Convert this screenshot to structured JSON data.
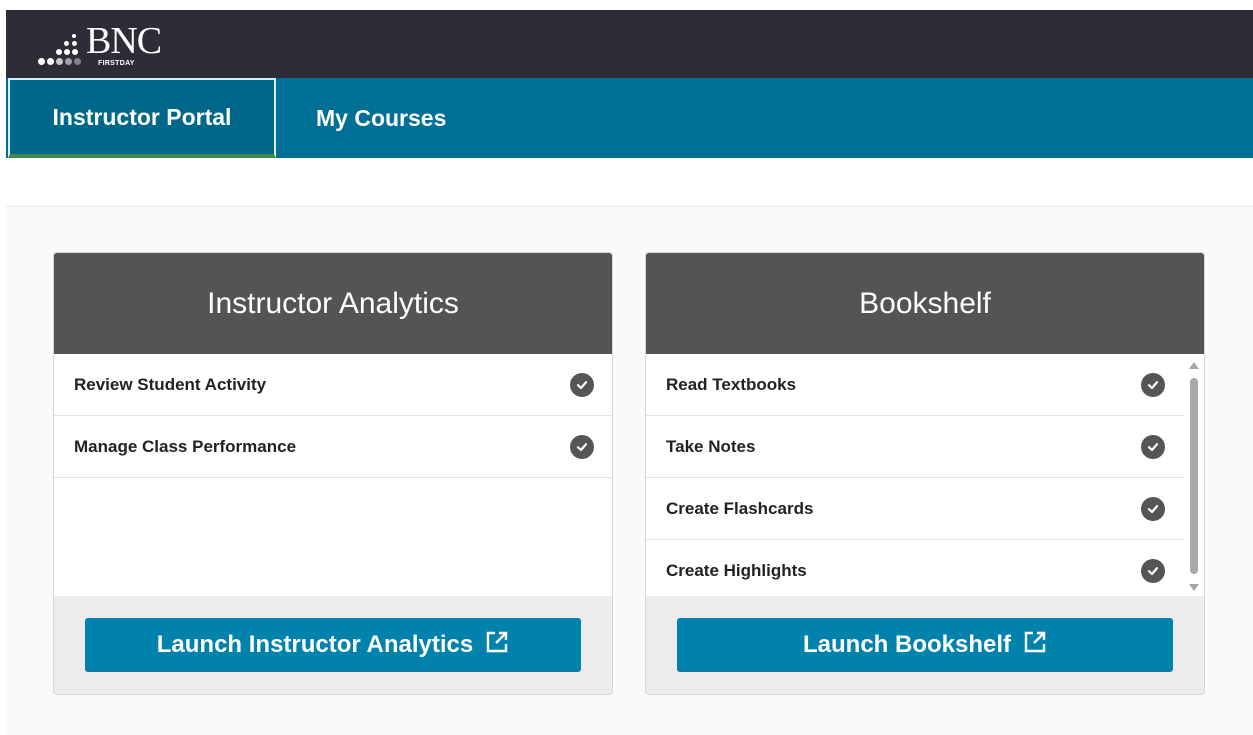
{
  "header": {
    "logo_text": "BNC",
    "logo_subtext": "FIRSTDAY"
  },
  "nav": {
    "tabs": [
      {
        "label": "Instructor Portal",
        "active": true
      },
      {
        "label": "My Courses",
        "active": false
      }
    ]
  },
  "cards": [
    {
      "title": "Instructor Analytics",
      "items": [
        {
          "label": "Review Student Activity",
          "icon": "check-circle-icon"
        },
        {
          "label": "Manage Class Performance",
          "icon": "check-circle-icon"
        }
      ],
      "button_label": "Launch Instructor Analytics",
      "button_icon": "external-link-icon"
    },
    {
      "title": "Bookshelf",
      "items": [
        {
          "label": "Read Textbooks",
          "icon": "check-circle-icon"
        },
        {
          "label": "Take Notes",
          "icon": "check-circle-icon"
        },
        {
          "label": "Create Flashcards",
          "icon": "check-circle-icon"
        },
        {
          "label": "Create Highlights",
          "icon": "check-circle-icon"
        }
      ],
      "button_label": "Launch Bookshelf",
      "button_icon": "external-link-icon"
    }
  ],
  "colors": {
    "topbar": "#2d2d38",
    "navbar": "#006f95",
    "card_header": "#545454",
    "button": "#0082ad",
    "active_tab_underline": "#3e8a4a"
  }
}
